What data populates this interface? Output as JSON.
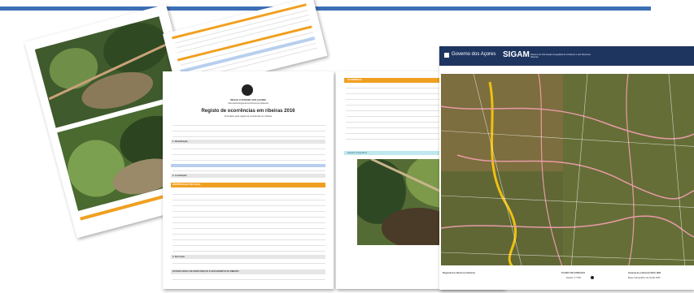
{
  "report": {
    "org1": "REGIÃO AUTÓNOMA DOS AÇORES",
    "org2": "Secretaria Regional dos Recursos Naturais",
    "title": "Registo de ocorrências em ribeiras 2016",
    "subtitle": "Formulário para registo de ocorrências em ribeiras",
    "section1": "1. Identificação",
    "section2": "2. Localização",
    "section3": "3. Descrição",
    "local_header": "IDENTIFICAÇÃO DO LOCAL",
    "state_header": "ESTADO GERAL DE MANUTENÇÃO E ESCOAMENTO DA RIBEIRA"
  },
  "report2": {
    "header": "OCORRÊNCIA",
    "reference": "Registos fotográficos"
  },
  "map": {
    "brand": "Governo dos Açores",
    "app": "SIGAM",
    "app_sub": "Sistema de Informação Geográfica do Ambiente e dos Recursos Naturais",
    "footer_org": "Regional dos Recursos Naturais",
    "footer_mid": "PLANTA DE CONSULTA",
    "footer_scale": "Escala: 1:7 500",
    "footer_right": "Sistema de referência WGS 1984",
    "footer_right2": "Mapa Cartográfico do IGeoE 2006"
  },
  "colors": {
    "accent": "#3c6fb4",
    "orange": "#f0a020",
    "map_header": "#1e3560"
  }
}
